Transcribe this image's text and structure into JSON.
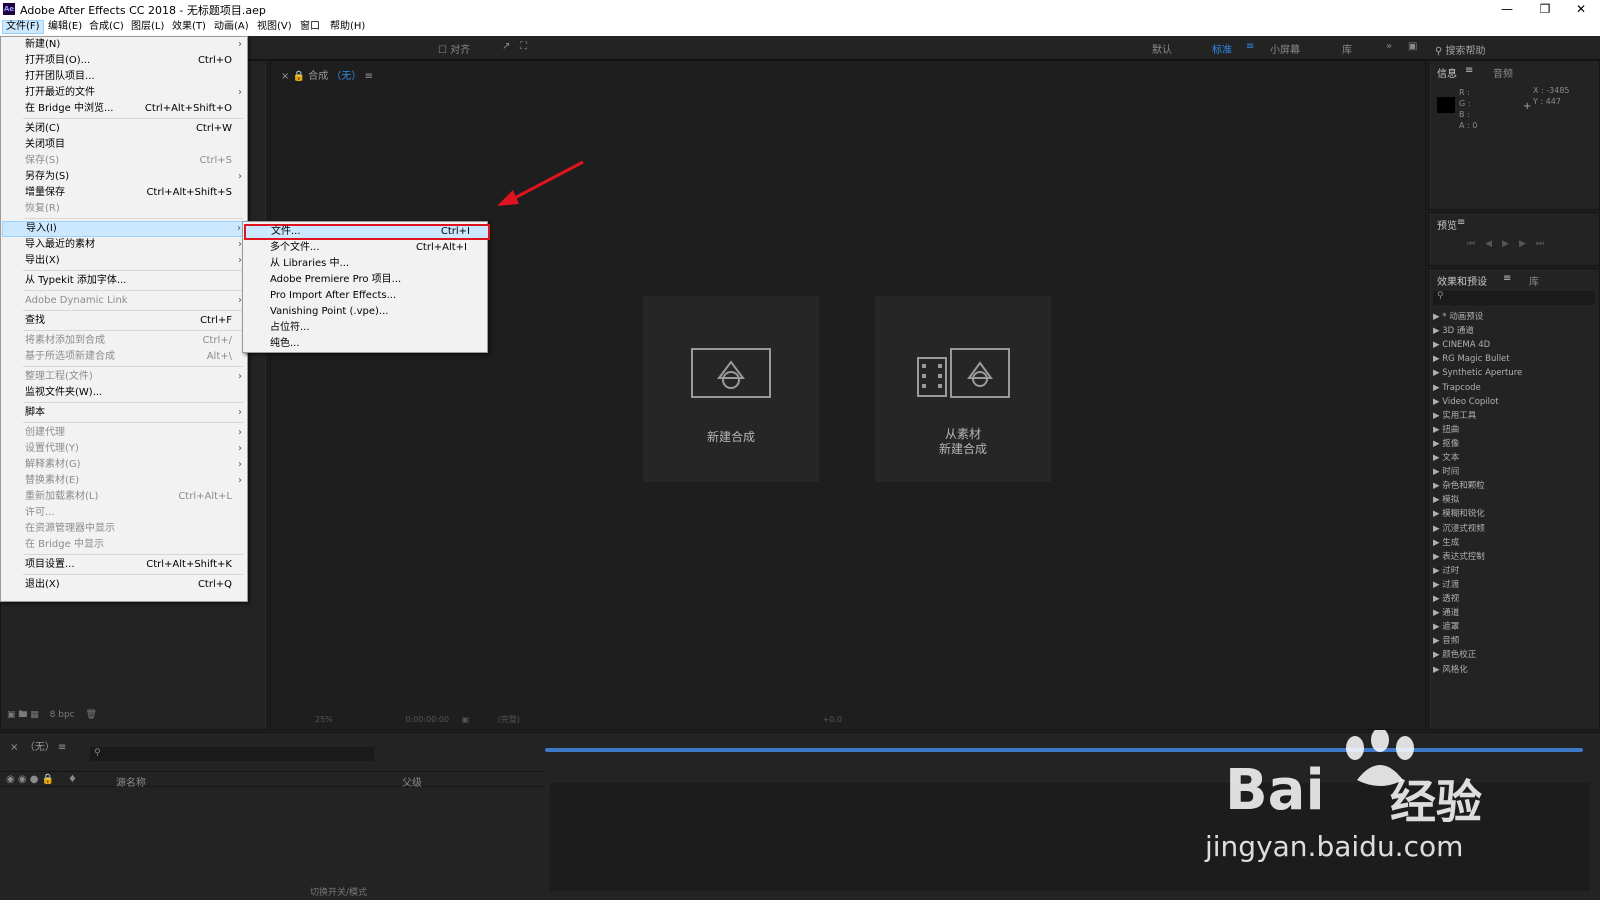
{
  "window": {
    "title": "Adobe After Effects CC 2018 - 无标题项目.aep",
    "logo": "Ae"
  },
  "menubar": {
    "items": [
      "文件(F)",
      "编辑(E)",
      "合成(C)",
      "图层(L)",
      "效果(T)",
      "动画(A)",
      "视图(V)",
      "窗口",
      "帮助(H)"
    ],
    "active": "文件(F)"
  },
  "toolbar": {
    "align_label": "对齐",
    "workspaces": [
      "默认",
      "标准",
      "小屏幕",
      "库"
    ],
    "active_workspace": "标准",
    "search_placeholder": "搜索帮助"
  },
  "file_menu": {
    "items": [
      {
        "label": "新建(N)",
        "shortcut": "",
        "submenu": true,
        "disabled": false
      },
      {
        "label": "打开项目(O)...",
        "shortcut": "Ctrl+O",
        "submenu": false,
        "disabled": false
      },
      {
        "label": "打开团队项目...",
        "shortcut": "",
        "submenu": false,
        "disabled": false
      },
      {
        "label": "打开最近的文件",
        "shortcut": "",
        "submenu": true,
        "disabled": false
      },
      {
        "label": "在 Bridge 中浏览...",
        "shortcut": "Ctrl+Alt+Shift+O",
        "submenu": false,
        "disabled": false
      },
      {
        "label": "关闭(C)",
        "shortcut": "Ctrl+W",
        "submenu": false,
        "disabled": false
      },
      {
        "label": "关闭项目",
        "shortcut": "",
        "submenu": false,
        "disabled": false
      },
      {
        "label": "保存(S)",
        "shortcut": "Ctrl+S",
        "submenu": false,
        "disabled": true
      },
      {
        "label": "另存为(S)",
        "shortcut": "",
        "submenu": true,
        "disabled": false
      },
      {
        "label": "增量保存",
        "shortcut": "Ctrl+Alt+Shift+S",
        "submenu": false,
        "disabled": false
      },
      {
        "label": "恢复(R)",
        "shortcut": "",
        "submenu": false,
        "disabled": true
      },
      {
        "label": "导入(I)",
        "shortcut": "",
        "submenu": true,
        "disabled": false,
        "highlighted": true
      },
      {
        "label": "导入最近的素材",
        "shortcut": "",
        "submenu": true,
        "disabled": false
      },
      {
        "label": "导出(X)",
        "shortcut": "",
        "submenu": true,
        "disabled": false
      },
      {
        "label": "从 Typekit 添加字体...",
        "shortcut": "",
        "submenu": false,
        "disabled": false
      },
      {
        "label": "Adobe Dynamic Link",
        "shortcut": "",
        "submenu": true,
        "disabled": true
      },
      {
        "label": "查找",
        "shortcut": "Ctrl+F",
        "submenu": false,
        "disabled": false
      },
      {
        "label": "将素材添加到合成",
        "shortcut": "Ctrl+/",
        "submenu": false,
        "disabled": true
      },
      {
        "label": "基于所选项新建合成",
        "shortcut": "Alt+\\",
        "submenu": false,
        "disabled": true
      },
      {
        "label": "整理工程(文件)",
        "shortcut": "",
        "submenu": true,
        "disabled": true
      },
      {
        "label": "监视文件夹(W)...",
        "shortcut": "",
        "submenu": false,
        "disabled": false
      },
      {
        "label": "脚本",
        "shortcut": "",
        "submenu": true,
        "disabled": false
      },
      {
        "label": "创建代理",
        "shortcut": "",
        "submenu": true,
        "disabled": true
      },
      {
        "label": "设置代理(Y)",
        "shortcut": "",
        "submenu": true,
        "disabled": true
      },
      {
        "label": "解释素材(G)",
        "shortcut": "",
        "submenu": true,
        "disabled": true
      },
      {
        "label": "替换素材(E)",
        "shortcut": "",
        "submenu": true,
        "disabled": true
      },
      {
        "label": "重新加载素材(L)",
        "shortcut": "Ctrl+Alt+L",
        "submenu": false,
        "disabled": true
      },
      {
        "label": "许可...",
        "shortcut": "",
        "submenu": false,
        "disabled": true
      },
      {
        "label": "在资源管理器中显示",
        "shortcut": "",
        "submenu": false,
        "disabled": true
      },
      {
        "label": "在 Bridge 中显示",
        "shortcut": "",
        "submenu": false,
        "disabled": true
      },
      {
        "label": "项目设置...",
        "shortcut": "Ctrl+Alt+Shift+K",
        "submenu": false,
        "disabled": false
      },
      {
        "label": "退出(X)",
        "shortcut": "Ctrl+Q",
        "submenu": false,
        "disabled": false
      }
    ]
  },
  "import_submenu": {
    "items": [
      {
        "label": "文件...",
        "shortcut": "Ctrl+I",
        "highlighted": true
      },
      {
        "label": "多个文件...",
        "shortcut": "Ctrl+Alt+I"
      },
      {
        "label": "从 Libraries 中...",
        "shortcut": ""
      },
      {
        "label": "Adobe Premiere Pro 项目...",
        "shortcut": ""
      },
      {
        "label": "Pro Import After Effects...",
        "shortcut": ""
      },
      {
        "label": "Vanishing Point (.vpe)...",
        "shortcut": ""
      },
      {
        "label": "占位符...",
        "shortcut": ""
      },
      {
        "label": "纯色...",
        "shortcut": ""
      }
    ]
  },
  "composition_panel": {
    "tab_prefix": "合成",
    "tab_value": "（无）",
    "new_comp_label": "新建合成",
    "from_footage_line1": "从素材",
    "from_footage_line2": "新建合成",
    "zoom": "25%",
    "timecode": "0:00:00:00",
    "resolution": "(完整)",
    "exposure": "+0.0"
  },
  "project_panel": {
    "bpc": "8 bpc"
  },
  "info_panel": {
    "title": "信息",
    "tab2": "音频",
    "rgb_labels": [
      "R :",
      "G :",
      "B :",
      "A : 0"
    ],
    "x": "X : -3485",
    "y": "Y : 447"
  },
  "preview_panel": {
    "title": "预览"
  },
  "effects_panel": {
    "title": "效果和预设",
    "tab2": "库",
    "items": [
      "* 动画预设",
      "3D 通道",
      "CINEMA 4D",
      "RG Magic Bullet",
      "Synthetic Aperture",
      "Trapcode",
      "Video Copilot",
      "实用工具",
      "扭曲",
      "抠像",
      "文本",
      "时间",
      "杂色和颗粒",
      "模拟",
      "模糊和锐化",
      "沉浸式视频",
      "生成",
      "表达式控制",
      "过时",
      "过渡",
      "透视",
      "通道",
      "遮罩",
      "音频",
      "颜色校正",
      "风格化"
    ]
  },
  "timeline": {
    "tab": "（无）",
    "col_source": "源名称",
    "col_parent": "父级",
    "toggle_label": "切换开关/模式"
  },
  "watermark": {
    "brand": "Bai",
    "brand2": "经验",
    "url": "jingyan.baidu.com"
  },
  "colors": {
    "accent": "#2d8ceb",
    "highlight": "#cce8ff",
    "annotation_red": "#e0141e"
  }
}
